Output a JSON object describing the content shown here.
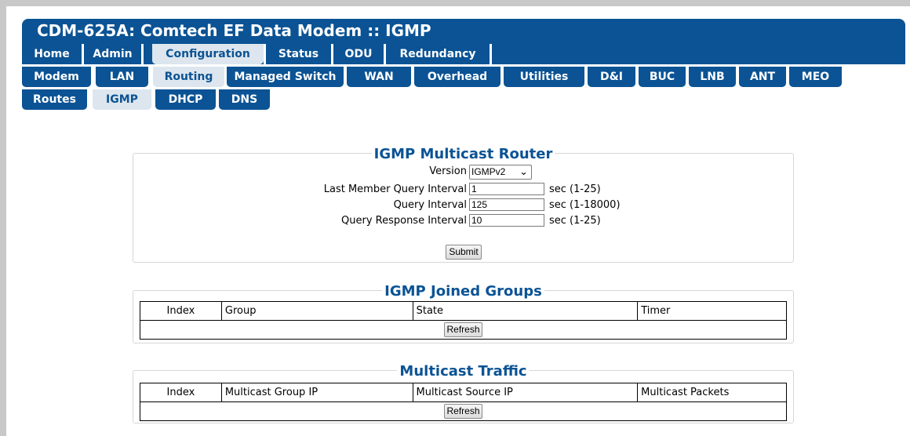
{
  "title": "CDM-625A: Comtech EF Data Modem :: IGMP",
  "nav": {
    "row1": [
      "Home",
      "Admin",
      "Configuration",
      "Status",
      "ODU",
      "Redundancy"
    ],
    "row2": [
      "Modem",
      "LAN",
      "Routing",
      "Managed Switch",
      "WAN",
      "Overhead",
      "Utilities",
      "D&I",
      "BUC",
      "LNB",
      "ANT",
      "MEO"
    ],
    "row3": [
      "Routes",
      "IGMP",
      "DHCP",
      "DNS"
    ],
    "active": {
      "row1": "Configuration",
      "row2": "Routing",
      "row3": "IGMP"
    }
  },
  "router": {
    "title": "IGMP Multicast Router",
    "version_label": "Version",
    "version_value": "IGMPv2",
    "fields": [
      {
        "label": "Last Member Query Interval",
        "value": "1",
        "unit": "sec (1-25)"
      },
      {
        "label": "Query Interval",
        "value": "125",
        "unit": "sec (1-18000)"
      },
      {
        "label": "Query Response Interval",
        "value": "10",
        "unit": "sec (1-25)"
      }
    ],
    "submit_label": "Submit"
  },
  "joined_groups": {
    "title": "IGMP Joined Groups",
    "columns": [
      "Index",
      "Group",
      "State",
      "Timer"
    ],
    "refresh_label": "Refresh"
  },
  "multicast_traffic": {
    "title": "Multicast Traffic",
    "columns": [
      "Index",
      "Multicast Group IP",
      "Multicast Source IP",
      "Multicast Packets"
    ],
    "refresh_label": "Refresh"
  },
  "colors": {
    "brand_blue": "#0b5394",
    "active_tab": "#dde6ee"
  }
}
